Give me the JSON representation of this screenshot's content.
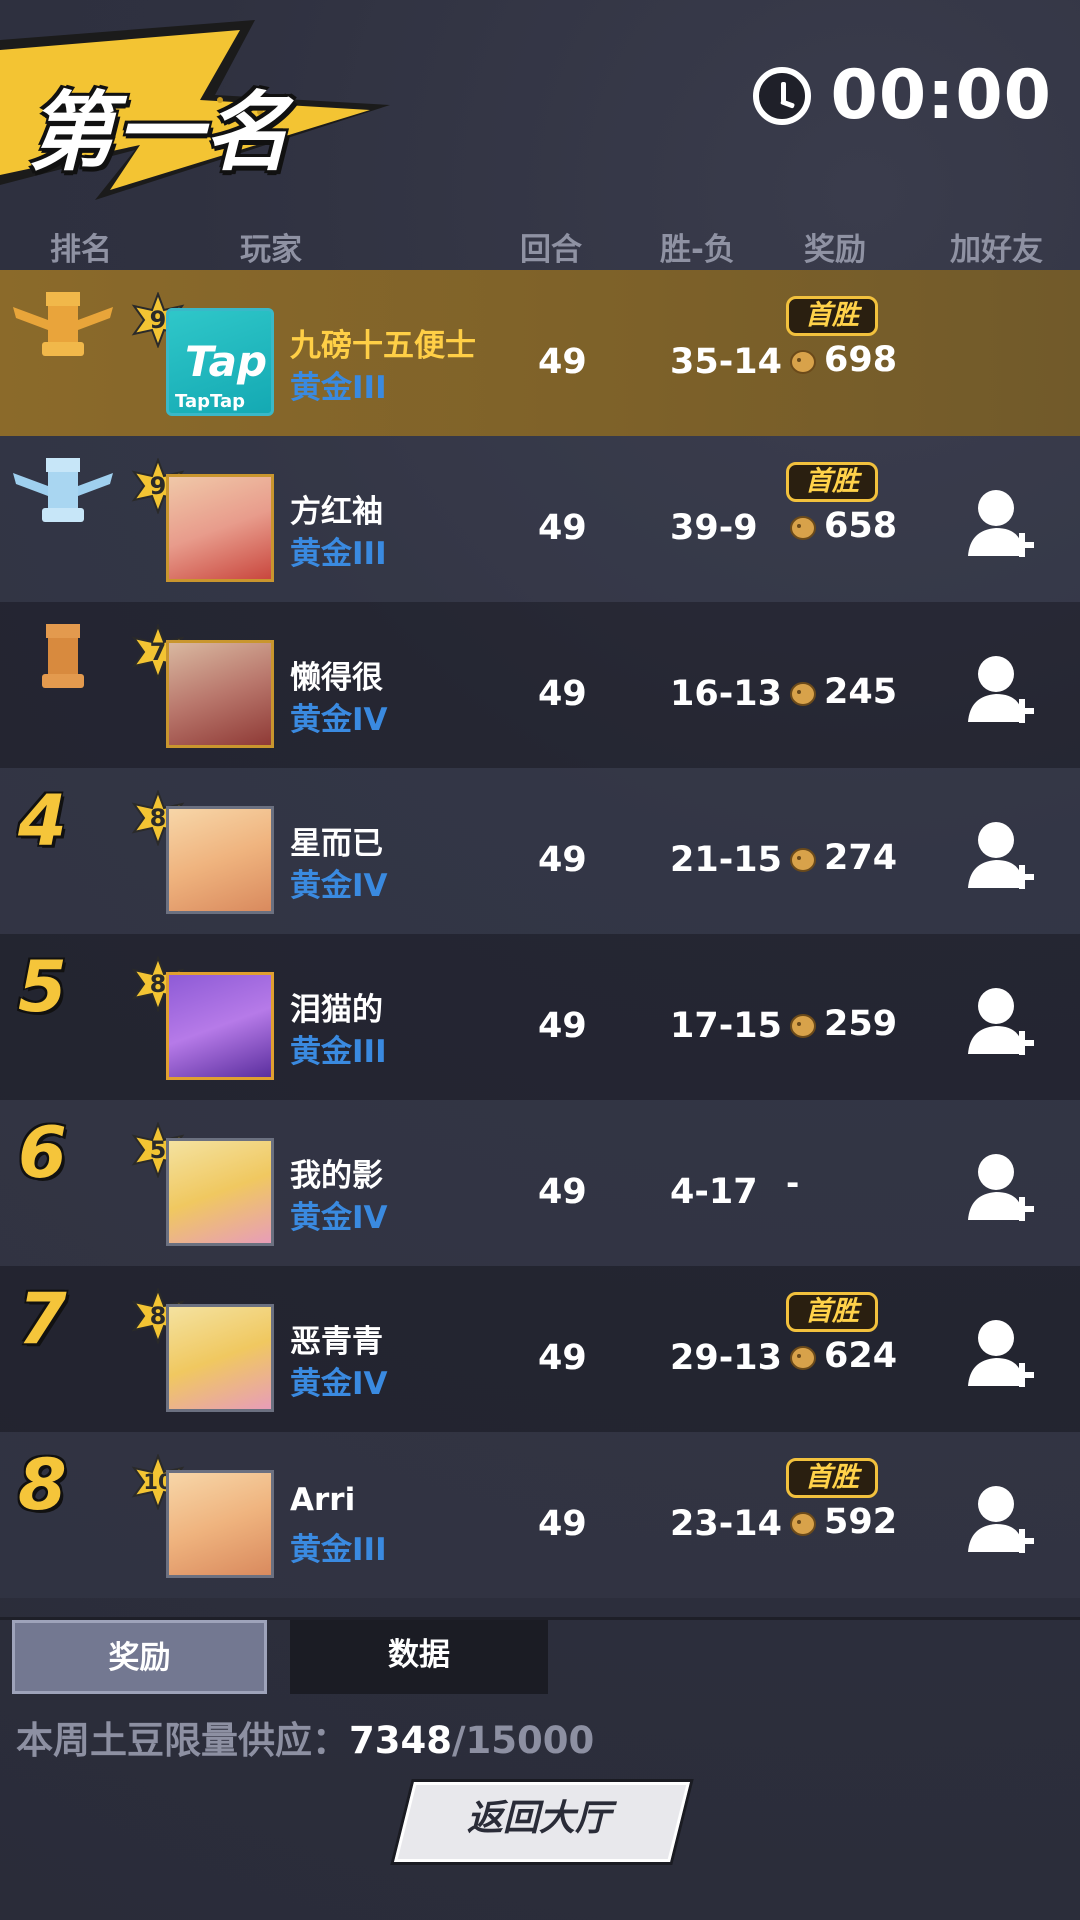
{
  "header": {
    "title": "第一名",
    "timer": "00:00"
  },
  "columns": {
    "rank": "排名",
    "player": "玩家",
    "round": "回合",
    "win_loss": "胜-负",
    "reward": "奖励",
    "add_friend": "加好友"
  },
  "rows": [
    {
      "rank": "1",
      "rank_icon": "gold-crown-icon",
      "level": "9",
      "avatar": "taptap-avatar",
      "name": "九磅十五便士",
      "tier": "黄金III",
      "round": "49",
      "win_loss": "35-14",
      "first_win": "首胜",
      "reward": "698"
    },
    {
      "rank": "2",
      "rank_icon": "silver-crown-icon",
      "level": "9",
      "avatar": "portrait",
      "name": "方红袖",
      "tier": "黄金III",
      "round": "49",
      "win_loss": "39-9",
      "first_win": "首胜",
      "reward": "658"
    },
    {
      "rank": "3",
      "rank_icon": "bronze-rook-icon",
      "level": "7",
      "avatar": "portrait",
      "name": "懒得很",
      "tier": "黄金IV",
      "round": "49",
      "win_loss": "16-13",
      "first_win": "",
      "reward": "245"
    },
    {
      "rank": "4",
      "level": "8",
      "avatar": "portrait",
      "name": "星而已",
      "tier": "黄金IV",
      "round": "49",
      "win_loss": "21-15",
      "first_win": "",
      "reward": "274"
    },
    {
      "rank": "5",
      "level": "8",
      "avatar": "portrait",
      "name": "泪猫的",
      "tier": "黄金III",
      "round": "49",
      "win_loss": "17-15",
      "first_win": "",
      "reward": "259"
    },
    {
      "rank": "6",
      "level": "5",
      "avatar": "portrait",
      "name": "我的影",
      "tier": "黄金IV",
      "round": "49",
      "win_loss": "4-17",
      "first_win": "",
      "reward": "-"
    },
    {
      "rank": "7",
      "level": "8",
      "avatar": "portrait",
      "name": "恶青青",
      "tier": "黄金IV",
      "round": "49",
      "win_loss": "29-13",
      "first_win": "首胜",
      "reward": "624"
    },
    {
      "rank": "8",
      "level": "10",
      "avatar": "portrait",
      "name": "Arri",
      "tier": "黄金III",
      "round": "49",
      "win_loss": "23-14",
      "first_win": "首胜",
      "reward": "592"
    }
  ],
  "tabs": {
    "reward": "奖励",
    "data": "数据"
  },
  "supply": {
    "label": "本周土豆限量供应：",
    "current": "7348",
    "total": "/15000"
  },
  "back_button": "返回大厅",
  "colors": {
    "gold": "#ffcf46",
    "tier_blue": "#3a8ae0",
    "first_row": "#7d6129"
  }
}
